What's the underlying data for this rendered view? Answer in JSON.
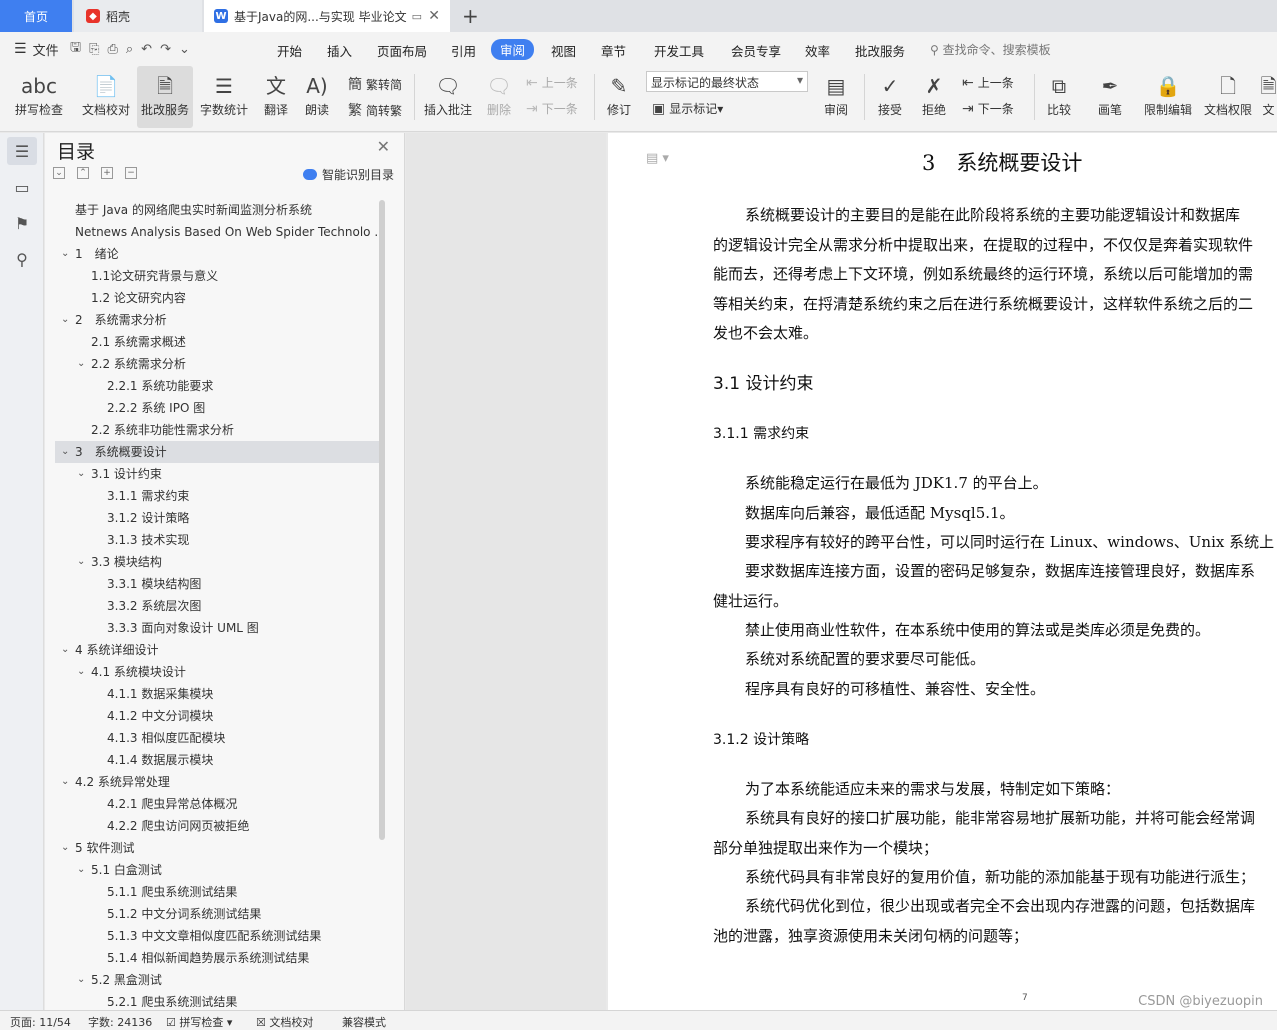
{
  "tabs": {
    "home": "首页",
    "daoke": "稻壳",
    "doc": "基于Java的网...与实现 毕业论文",
    "add": "+"
  },
  "menu": {
    "file": "文件",
    "items": [
      "开始",
      "插入",
      "页面布局",
      "引用",
      "审阅",
      "视图",
      "章节",
      "开发工具",
      "会员专享",
      "效率",
      "批改服务"
    ],
    "search": "查找命令、搜索模板"
  },
  "ribbon": {
    "spellcheck": "拼写检查",
    "doccheck": "文档校对",
    "correction": "批改服务",
    "wordcount": "字数统计",
    "translate": "翻译",
    "read": "朗读",
    "trad_to_simp": "繁转简",
    "simp_to_trad": "简转繁",
    "insert_comment": "插入批注",
    "delete": "删除",
    "prev": "上一条",
    "next": "下一条",
    "revise": "修订",
    "markstate": "显示标记的最终状态",
    "showmark": "显示标记",
    "review": "审阅",
    "accept": "接受",
    "reject": "拒绝",
    "prev2": "上一条",
    "next2": "下一条",
    "compare": "比较",
    "pen": "画笔",
    "restrict": "限制编辑",
    "docperm": "文档权限",
    "more": "文"
  },
  "toc": {
    "title": "目录",
    "smart": "智能识别目录",
    "items": [
      {
        "level": 0,
        "text": "基于 Java 的网络爬虫实时新闻监测分析系统",
        "caret": false
      },
      {
        "level": 0,
        "text": "Netnews Analysis Based On Web Spider Technolo ...",
        "caret": false
      },
      {
        "level": 0,
        "text": "1　绪论",
        "caret": true
      },
      {
        "level": 1,
        "text": "1.1论文研究背景与意义",
        "caret": false
      },
      {
        "level": 1,
        "text": "1.2  论文研究内容",
        "caret": false
      },
      {
        "level": 0,
        "text": "2　系统需求分析",
        "caret": true
      },
      {
        "level": 1,
        "text": "2.1  系统需求概述",
        "caret": false
      },
      {
        "level": 1,
        "text": "2.2  系统需求分析",
        "caret": true
      },
      {
        "level": 2,
        "text": "2.2.1  系统功能要求",
        "caret": false
      },
      {
        "level": 2,
        "text": "2.2.2  系统 IPO 图",
        "caret": false
      },
      {
        "level": 1,
        "text": "2.2  系统非功能性需求分析",
        "caret": false
      },
      {
        "level": 0,
        "text": "3　系统概要设计",
        "caret": true,
        "selected": true
      },
      {
        "level": 1,
        "text": "3.1  设计约束",
        "caret": true
      },
      {
        "level": 2,
        "text": "3.1.1  需求约束",
        "caret": false
      },
      {
        "level": 2,
        "text": "3.1.2  设计策略",
        "caret": false
      },
      {
        "level": 2,
        "text": "3.1.3  技术实现",
        "caret": false
      },
      {
        "level": 1,
        "text": "3.3  模块结构",
        "caret": true
      },
      {
        "level": 2,
        "text": "3.3.1  模块结构图",
        "caret": false
      },
      {
        "level": 2,
        "text": "3.3.2  系统层次图",
        "caret": false
      },
      {
        "level": 2,
        "text": "3.3.3  面向对象设计 UML 图",
        "caret": false
      },
      {
        "level": 0,
        "text": "4  系统详细设计",
        "caret": true
      },
      {
        "level": 1,
        "text": "4.1  系统模块设计",
        "caret": true
      },
      {
        "level": 2,
        "text": "4.1.1  数据采集模块",
        "caret": false
      },
      {
        "level": 2,
        "text": "4.1.2  中文分词模块",
        "caret": false
      },
      {
        "level": 2,
        "text": "4.1.3  相似度匹配模块",
        "caret": false
      },
      {
        "level": 2,
        "text": "4.1.4  数据展示模块",
        "caret": false
      },
      {
        "level": 0,
        "text": "4.2  系统异常处理",
        "caret": true
      },
      {
        "level": 2,
        "text": "4.2.1  爬虫异常总体概况",
        "caret": false
      },
      {
        "level": 2,
        "text": "4.2.2  爬虫访问网页被拒绝",
        "caret": false
      },
      {
        "level": 0,
        "text": "5  软件测试",
        "caret": true
      },
      {
        "level": 1,
        "text": "5.1  白盒测试",
        "caret": true
      },
      {
        "level": 2,
        "text": "5.1.1  爬虫系统测试结果",
        "caret": false
      },
      {
        "level": 2,
        "text": "5.1.2  中文分词系统测试结果",
        "caret": false
      },
      {
        "level": 2,
        "text": "5.1.3  中文文章相似度匹配系统测试结果",
        "caret": false
      },
      {
        "level": 2,
        "text": "5.1.4  相似新闻趋势展示系统测试结果",
        "caret": false
      },
      {
        "level": 1,
        "text": "5.2  黑盒测试",
        "caret": true
      },
      {
        "level": 2,
        "text": "5.2.1  爬虫系统测试结果",
        "caret": false
      }
    ]
  },
  "document": {
    "h1": "3　系统概要设计",
    "intro": [
      "系统概要设计的主要目的是能在此阶段将系统的主要功能逻辑设计和数据库",
      "的逻辑设计完全从需求分析中提取出来，在提取的过程中，不仅仅是奔着实现软件",
      "能而去，还得考虑上下文环境，例如系统最终的运行环境，系统以后可能增加的需",
      "等相关约束，在捋清楚系统约束之后在进行系统概要设计，这样软件系统之后的二",
      "发也不会太难。"
    ],
    "h2_31": "3.1  设计约束",
    "h3_311": "3.1.1  需求约束",
    "req": [
      "系统能稳定运行在最低为 JDK1.7 的平台上。",
      "数据库向后兼容，最低适配 Mysql5.1。",
      "要求程序有较好的跨平台性，可以同时运行在 Linux、windows、Unix 系统上",
      "要求数据库连接方面，设置的密码足够复杂，数据库连接管理良好，数据库系",
      "健壮运行。",
      "禁止使用商业性软件，在本系统中使用的算法或是类库必须是免费的。",
      "系统对系统配置的要求要尽可能低。",
      "程序具有良好的可移植性、兼容性、安全性。"
    ],
    "h3_312": "3.1.2  设计策略",
    "strategy": [
      "为了本系统能适应未来的需求与发展，特制定如下策略：",
      "系统具有良好的接口扩展功能，能非常容易地扩展新功能，并将可能会经常调",
      "部分单独提取出来作为一个模块；",
      "系统代码具有非常良好的复用价值，新功能的添加能基于现有功能进行派生；",
      "系统代码优化到位，很少出现或者完全不会出现内存泄露的问题，包括数据库",
      "池的泄露，独享资源使用未关闭句柄的问题等；"
    ],
    "pagenum": "7"
  },
  "status": {
    "page": "页面: 11/54",
    "words": "字数: 24136",
    "spell": "拼写检查",
    "doccheck": "文档校对",
    "compat": "兼容模式"
  },
  "watermark": "CSDN @biyezuopin"
}
